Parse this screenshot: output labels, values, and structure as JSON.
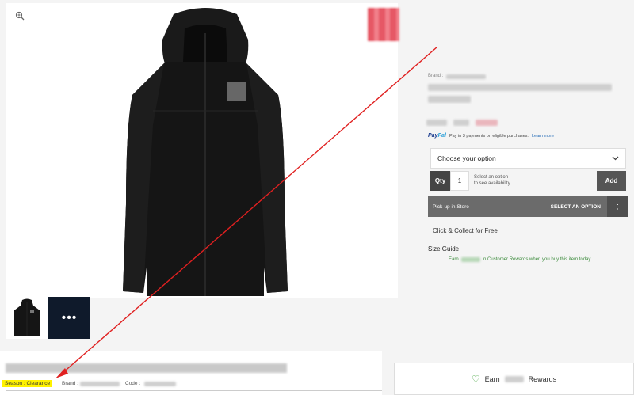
{
  "gallery": {
    "zoom_icon": "magnifier-icon",
    "more_label": "•••"
  },
  "product": {
    "brand_label": "Brand :",
    "paypal": {
      "logo_pay": "Pay",
      "logo_pal": "Pal",
      "text": "Pay in 3 payments on eligible purchases.",
      "link": "Learn more"
    },
    "option_select": "Choose your option",
    "qty_label": "Qty",
    "qty_value": "1",
    "qty_hint_1": "Select an option",
    "qty_hint_2": "to see availability",
    "add_label": "Add",
    "pickup_label": "Pick-up in Store",
    "pickup_select": "SELECT AN OPTION",
    "click_collect": "Click & Collect for Free",
    "size_guide": "Size Guide",
    "rewards_prefix": "Earn",
    "rewards_suffix": "in Customer Rewards when you buy this item today"
  },
  "bottom": {
    "season": "Season : Clearance",
    "brand_label": "Brand :",
    "code_label": "Code :",
    "earn_prefix": "Earn",
    "earn_suffix": "Rewards"
  },
  "colors": {
    "annotation_arrow": "#e02020",
    "highlight": "#fff200",
    "rewards_green": "#3a8a3a"
  }
}
